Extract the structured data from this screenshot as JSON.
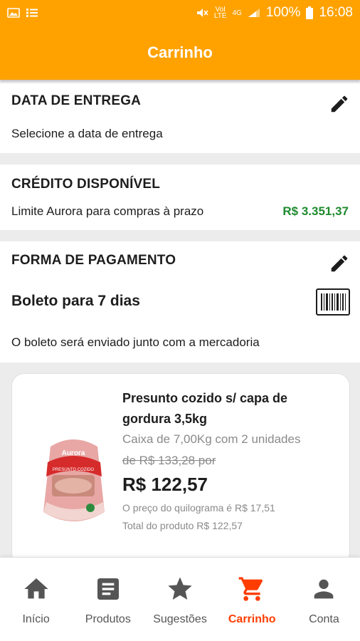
{
  "status_bar": {
    "battery": "100%",
    "time": "16:08",
    "network": "4G"
  },
  "header": {
    "title": "Carrinho"
  },
  "delivery": {
    "title": "DATA DE ENTREGA",
    "text": "Selecione a data de entrega"
  },
  "credit": {
    "title": "CRÉDITO DISPONÍVEL",
    "label": "Limite Aurora para compras à prazo",
    "value": "R$ 3.351,37"
  },
  "payment": {
    "title": "FORMA DE PAGAMENTO",
    "method": "Boleto para 7 dias",
    "note": "O boleto será enviado junto com a mercadoria"
  },
  "product": {
    "name": "Presunto cozido s/ capa de gordura 3,5kg",
    "box": "Caixa de 7,00Kg com 2 unidades",
    "old_price": "de R$ 133,28 por",
    "price": "R$ 122,57",
    "kg_price": "O preço do quilograma é R$ 17,51",
    "total": "Total do produto R$ 122,57",
    "image_brand": "Aurora",
    "image_subtitle": "PRESUNTO COZIDO"
  },
  "nav": {
    "items": [
      {
        "label": "Início",
        "icon": "home-icon"
      },
      {
        "label": "Produtos",
        "icon": "list-icon"
      },
      {
        "label": "Sugestões",
        "icon": "star-icon"
      },
      {
        "label": "Carrinho",
        "icon": "cart-icon"
      },
      {
        "label": "Conta",
        "icon": "person-icon"
      }
    ],
    "active_index": 3
  },
  "colors": {
    "brand": "#ffa200",
    "credit_value": "#1e8a2e",
    "active_nav": "#ff3d00"
  }
}
